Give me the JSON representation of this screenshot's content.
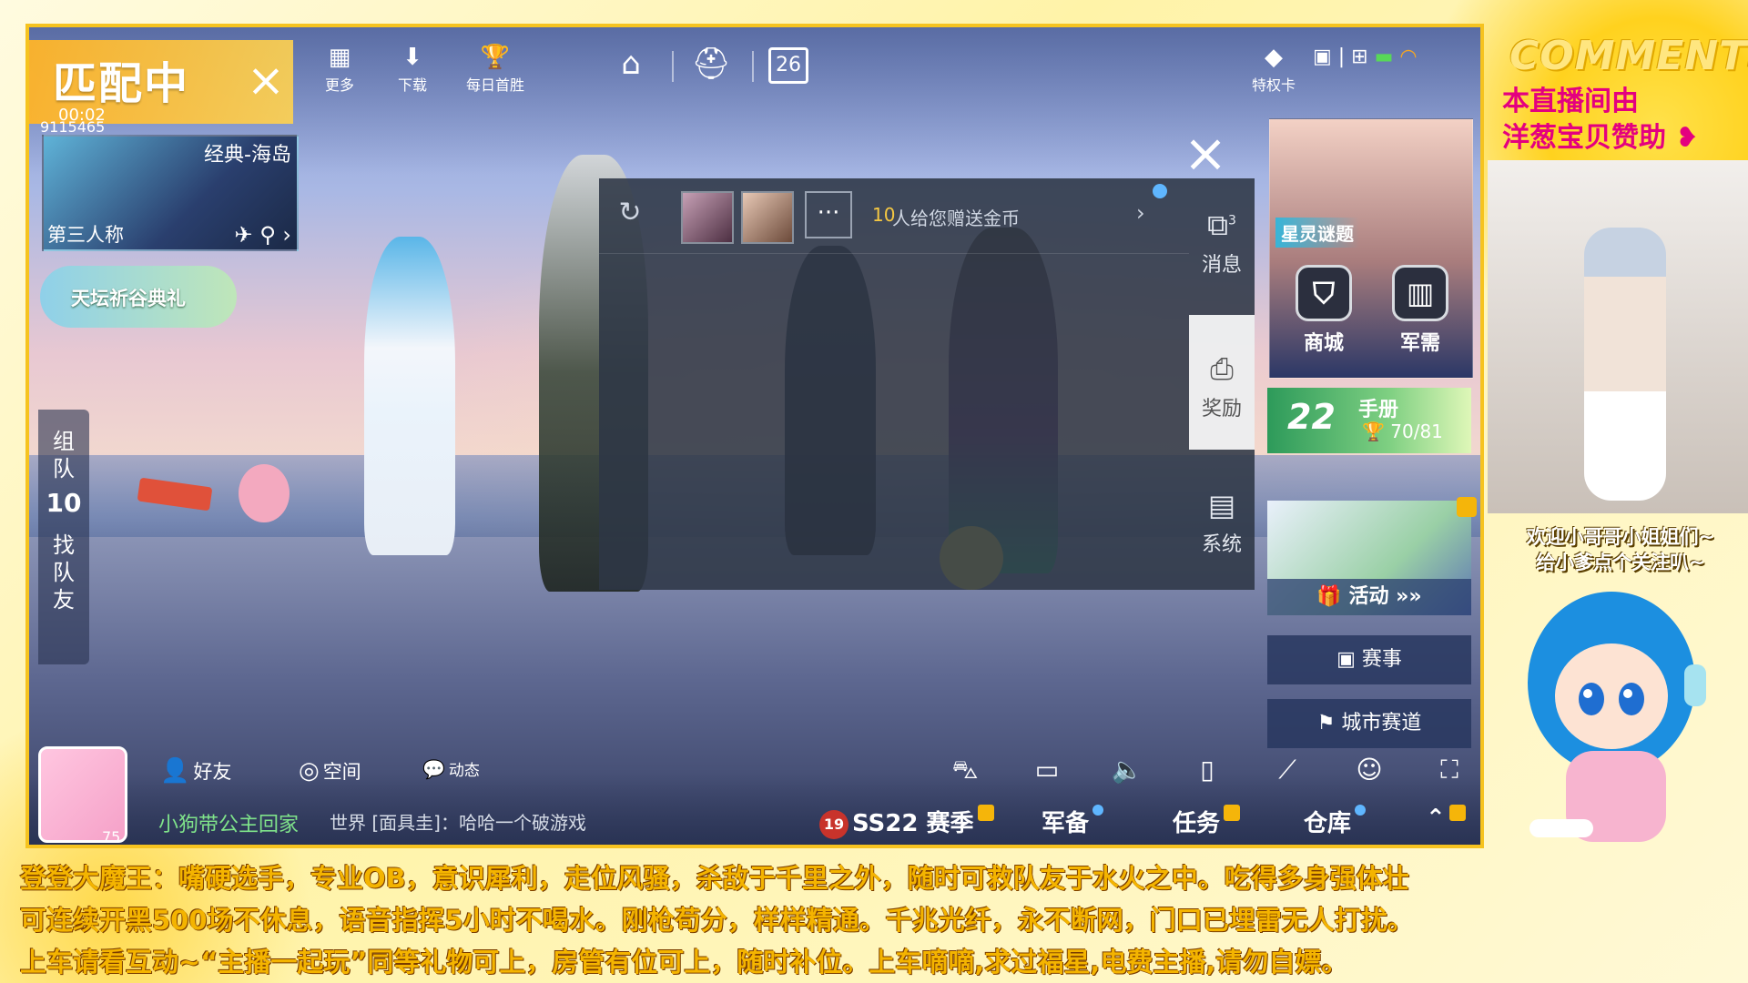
{
  "matching": {
    "title": "匹配中",
    "timer": "00:02",
    "room_id": "9115465"
  },
  "map": {
    "name": "经典-海岛",
    "perspective": "第三人称"
  },
  "event": {
    "label": "天坛祈谷典礼"
  },
  "top_bar": {
    "more": "更多",
    "download": "下载",
    "daily_win": "每日首胜",
    "calendar_day": "26",
    "privilege_card": "特权卡"
  },
  "squad_tab": {
    "team_label": [
      "组",
      "队"
    ],
    "team_count": "10",
    "find_label": [
      "找",
      "队",
      "友"
    ]
  },
  "messages": {
    "gift_count": "10",
    "gift_text": "人给您赠送金币",
    "more_symbol": "···"
  },
  "side_tabs": {
    "messages": "消息",
    "messages_badge": "3",
    "rewards": "奖励",
    "system": "系统"
  },
  "right_panel": {
    "hero_tag": "星灵谜题",
    "shop": "商城",
    "supply": "军需",
    "pass_season": "22",
    "pass_label": "手册",
    "pass_progress": "70/81",
    "activity": "活动",
    "tournament": "赛事",
    "city_race": "城市赛道"
  },
  "bottom": {
    "friends": "好友",
    "space": "空间",
    "moments": "动态",
    "profile_level": "75",
    "player_name": "小狗带公主回家",
    "chat_channel": "世界",
    "chat_message": "[面具圭]：哈哈一个破游戏",
    "season_level": "19",
    "season": "SS22 赛季",
    "armory": "军备",
    "tasks": "任务",
    "warehouse": "仓库"
  },
  "overlay": {
    "comments_title": "COMMENTS",
    "sponsor_line1": "本直播间由",
    "sponsor_line2": "洋葱宝贝赞助",
    "welcome_line1": "欢迎小哥哥小姐姐们~",
    "welcome_line2": "给小爹点个关注叭~"
  },
  "ticker": {
    "line1": "登登大魔王：嘴硬选手，专业OB，意识犀利，走位风骚，杀敌于千里之外，随时可救队友于水火之中。吃得多身强体壮",
    "line2": "可连续开黑500场不休息，语音指挥5小时不喝水。刚枪苟分，样样精通。千兆光纤，永不断网，门口已埋雷无人打扰。",
    "line3": "上车请看互动~“主播一起玩”同等礼物可上，房管有位可上，随时补位。上车嘀嘀,求过福星,电费主播,请勿自嫖。"
  },
  "colors": {
    "accent_gold": "#f6c31f",
    "ticker_text": "#f4b400",
    "sponsor_pink": "#e4007f",
    "player_name": "#7fe38a"
  }
}
